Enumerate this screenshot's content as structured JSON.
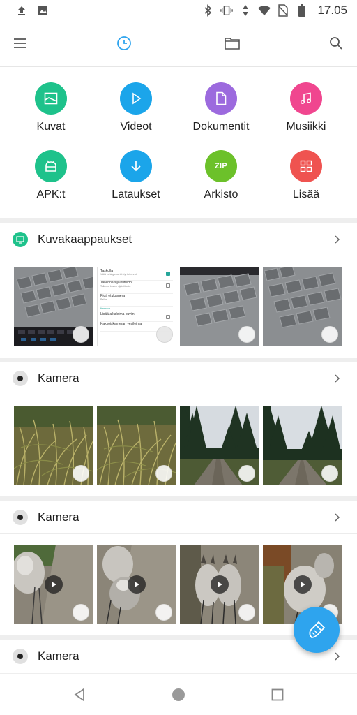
{
  "status_bar": {
    "time": "17.05",
    "left_icons": [
      "upload-notification-icon",
      "image-notification-icon"
    ],
    "right_icons": [
      "bluetooth-icon",
      "vibrate-icon",
      "data-transfer-icon",
      "wifi-icon",
      "no-sim-icon",
      "battery-icon"
    ]
  },
  "toolbar": {
    "menu_icon": "menu-icon",
    "recent_icon": "clock-icon",
    "folder_icon": "folder-icon",
    "search_icon": "search-icon",
    "active_color": "#2ea4ee"
  },
  "categories": [
    {
      "label": "Kuvat",
      "icon": "image-icon",
      "color": "#1ec28b"
    },
    {
      "label": "Videot",
      "icon": "play-icon",
      "color": "#1ba5ea"
    },
    {
      "label": "Dokumentit",
      "icon": "document-icon",
      "color": "#9c6ade"
    },
    {
      "label": "Musiikki",
      "icon": "music-icon",
      "color": "#f0468f"
    },
    {
      "label": "APK:t",
      "icon": "android-icon",
      "color": "#1ec28b"
    },
    {
      "label": "Lataukset",
      "icon": "download-icon",
      "color": "#1ba5ea"
    },
    {
      "label": "Arkisto",
      "icon": "zip-icon",
      "icon_text": "ZIP",
      "color": "#6cc12a"
    },
    {
      "label": "Lisää",
      "icon": "grid-icon",
      "color": "#ef5350"
    }
  ],
  "sections": [
    {
      "title": "Kuvakaappaukset",
      "icon": "screenshot-icon",
      "icon_color": "#1ec28b",
      "items": [
        {
          "type": "keyboard"
        },
        {
          "type": "settings"
        },
        {
          "type": "keyboard"
        },
        {
          "type": "keyboard"
        }
      ]
    },
    {
      "title": "Kamera",
      "icon": "camera-dot-icon",
      "icon_color": "#e0e0e0",
      "items": [
        {
          "type": "grass"
        },
        {
          "type": "grass"
        },
        {
          "type": "forest"
        },
        {
          "type": "forest"
        }
      ]
    },
    {
      "title": "Kamera",
      "icon": "camera-dot-icon",
      "icon_color": "#e0e0e0",
      "items": [
        {
          "type": "dog-video"
        },
        {
          "type": "dog-video"
        },
        {
          "type": "dog-video"
        },
        {
          "type": "dog-video"
        }
      ]
    },
    {
      "title": "Kamera",
      "icon": "camera-dot-icon",
      "icon_color": "#e0e0e0",
      "items": []
    }
  ],
  "settings_screenshot": {
    "rows": [
      {
        "title": "Taskulla",
        "sub": "Vältä vahingossa tehdyt toiminnot",
        "checked": true
      },
      {
        "title": "Tallenna sijaintitiedot",
        "sub": "Tallenna kuvien sijaintitiedot",
        "checked": false
      },
      {
        "title": "Pidä etukamera",
        "sub": "Peilaa",
        "checked": false
      }
    ],
    "category": "Kamera",
    "rows2": [
      {
        "title": "Lisää aikaleima kuviin",
        "sub": "",
        "checked": false
      },
      {
        "title": "Kaksoiskameran vesileima",
        "sub": "",
        "checked": false
      }
    ]
  },
  "fab": {
    "icon": "clean-brush-icon",
    "color": "#2ea4ee"
  },
  "nav_bar": {
    "back_icon": "back-icon",
    "home_icon": "home-icon",
    "recents_icon": "recents-icon"
  }
}
